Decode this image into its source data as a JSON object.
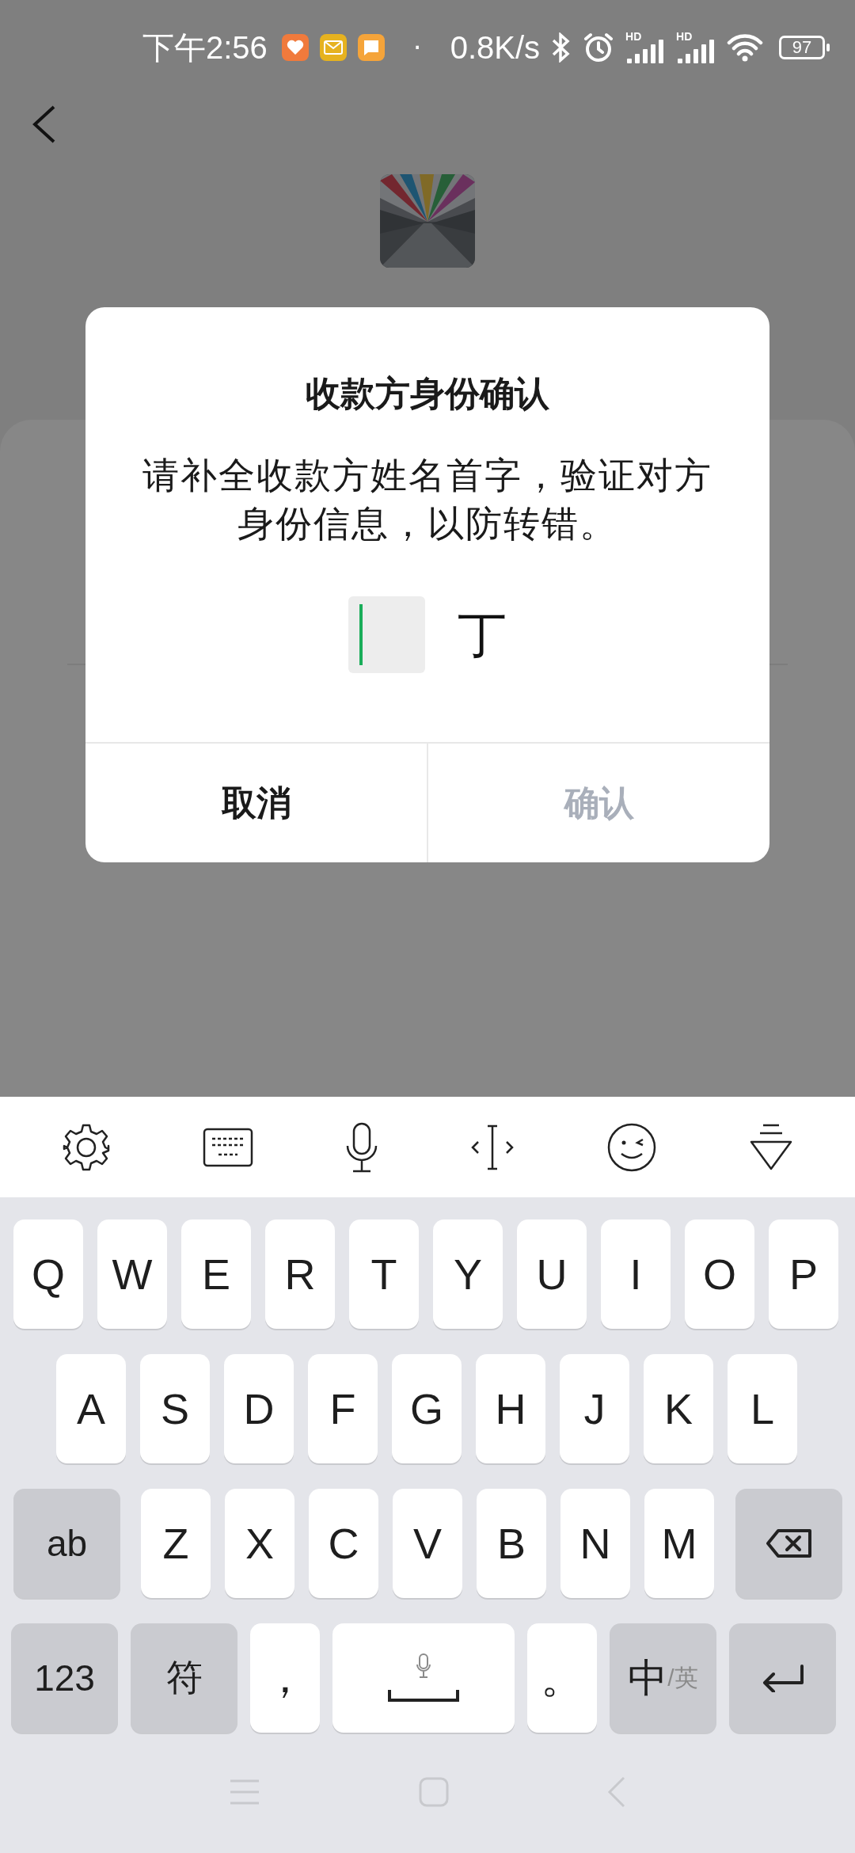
{
  "status_bar": {
    "time": "下午2:56",
    "notifications": [
      {
        "kind": "health"
      },
      {
        "kind": "mail"
      },
      {
        "kind": "message"
      }
    ],
    "separator": "·",
    "net_speed": "0.8K/s",
    "signal_labels": [
      "HD",
      "HD"
    ],
    "battery": "97"
  },
  "dialog": {
    "title": "收款方身份确认",
    "message": "请补全收款方姓名首字，验证对方身份信息，以防转错。",
    "name_input": {
      "focused": true
    },
    "name_rest": "丁",
    "buttons": [
      {
        "label": "取消",
        "disabled": false
      },
      {
        "label": "确认",
        "disabled": true
      }
    ]
  },
  "keyboard": {
    "rows": [
      {
        "keys": [
          {
            "kind": "letter",
            "label": "Q"
          },
          {
            "kind": "letter",
            "label": "W"
          },
          {
            "kind": "letter",
            "label": "E"
          },
          {
            "kind": "letter",
            "label": "R"
          },
          {
            "kind": "letter",
            "label": "T"
          },
          {
            "kind": "letter",
            "label": "Y"
          },
          {
            "kind": "letter",
            "label": "U"
          },
          {
            "kind": "letter",
            "label": "I"
          },
          {
            "kind": "letter",
            "label": "O"
          },
          {
            "kind": "letter",
            "label": "P"
          }
        ]
      },
      {
        "keys": [
          {
            "kind": "letter",
            "label": "A"
          },
          {
            "kind": "letter",
            "label": "S"
          },
          {
            "kind": "letter",
            "label": "D"
          },
          {
            "kind": "letter",
            "label": "F"
          },
          {
            "kind": "letter",
            "label": "G"
          },
          {
            "kind": "letter",
            "label": "H"
          },
          {
            "kind": "letter",
            "label": "J"
          },
          {
            "kind": "letter",
            "label": "K"
          },
          {
            "kind": "letter",
            "label": "L"
          }
        ]
      },
      {
        "keys": [
          {
            "kind": "function",
            "label": "ab"
          },
          {
            "kind": "letter",
            "label": "Z"
          },
          {
            "kind": "letter",
            "label": "X"
          },
          {
            "kind": "letter",
            "label": "C"
          },
          {
            "kind": "letter",
            "label": "V"
          },
          {
            "kind": "letter",
            "label": "B"
          },
          {
            "kind": "letter",
            "label": "N"
          },
          {
            "kind": "letter",
            "label": "M"
          },
          {
            "kind": "backspace"
          }
        ]
      },
      {
        "keys": [
          {
            "kind": "function",
            "label": "123"
          },
          {
            "kind": "function",
            "label": "符"
          },
          {
            "kind": "punct",
            "label": "，"
          },
          {
            "kind": "space"
          },
          {
            "kind": "punct",
            "label": "。"
          },
          {
            "kind": "language",
            "label": "中",
            "secondary": "/英"
          },
          {
            "kind": "enter"
          }
        ]
      }
    ]
  }
}
